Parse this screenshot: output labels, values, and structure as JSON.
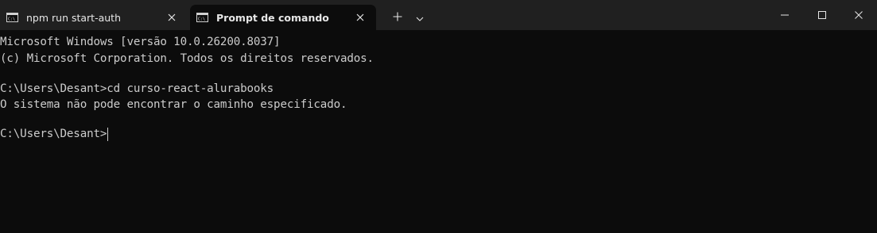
{
  "tabs": [
    {
      "label": "npm run start-auth",
      "active": false,
      "icon": "terminal-icon"
    },
    {
      "label": "Prompt de comando",
      "active": true,
      "icon": "terminal-icon"
    }
  ],
  "titlebar": {
    "new_tab_icon": "plus-icon",
    "dropdown_icon": "chevron-down-icon",
    "minimize_icon": "minimize-icon",
    "maximize_icon": "maximize-icon",
    "close_icon": "close-icon"
  },
  "console": {
    "lines": [
      "Microsoft Windows [versão 10.0.26200.8037]",
      "(c) Microsoft Corporation. Todos os direitos reservados.",
      "C:\\Users\\Desant>cd curso-react-alurabooks",
      "O sistema não pode encontrar o caminho especificado.",
      "C:\\Users\\Desant>"
    ]
  },
  "colors": {
    "background": "#0c0c0c",
    "titlebar": "#202020",
    "text": "#cccccc"
  }
}
